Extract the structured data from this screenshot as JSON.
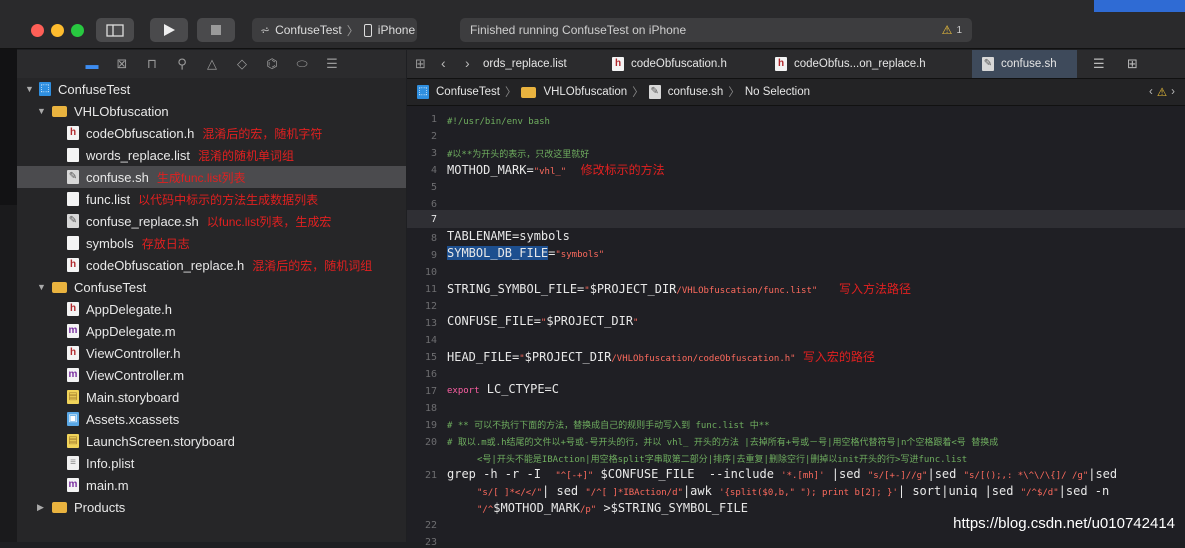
{
  "toolbar": {
    "scheme_name": "ConfuseTest",
    "device_name": "iPhone",
    "status_text": "Finished running ConfuseTest on iPhone",
    "warning_count": "1"
  },
  "navigator": {
    "icons": [
      "folder-icon",
      "x-square-icon",
      "hierarchy-icon",
      "search-icon",
      "warning-icon",
      "diamond-icon",
      "debug-icon",
      "tag-icon",
      "list-icon"
    ],
    "items": [
      {
        "label": "ConfuseTest",
        "note": ""
      },
      {
        "label": "VHLObfuscation",
        "note": ""
      },
      {
        "label": "codeObfuscation.h",
        "note": "混淆后的宏，随机字符"
      },
      {
        "label": "words_replace.list",
        "note": "混淆的随机单词组"
      },
      {
        "label": "confuse.sh",
        "note": "生成func.list列表"
      },
      {
        "label": "func.list",
        "note": "以代码中标示的方法生成数据列表"
      },
      {
        "label": "confuse_replace.sh",
        "note": "以func.list列表，生成宏"
      },
      {
        "label": "symbols",
        "note": "存放日志"
      },
      {
        "label": "codeObfuscation_replace.h",
        "note": "混淆后的宏，随机词组"
      },
      {
        "label": "ConfuseTest",
        "note": ""
      },
      {
        "label": "AppDelegate.h",
        "note": ""
      },
      {
        "label": "AppDelegate.m",
        "note": ""
      },
      {
        "label": "ViewController.h",
        "note": ""
      },
      {
        "label": "ViewController.m",
        "note": ""
      },
      {
        "label": "Main.storyboard",
        "note": ""
      },
      {
        "label": "Assets.xcassets",
        "note": ""
      },
      {
        "label": "LaunchScreen.storyboard",
        "note": ""
      },
      {
        "label": "Info.plist",
        "note": ""
      },
      {
        "label": "main.m",
        "note": ""
      },
      {
        "label": "Products",
        "note": ""
      }
    ]
  },
  "tabs": [
    {
      "label": "ords_replace.list"
    },
    {
      "label": "codeObfuscation.h"
    },
    {
      "label": "codeObfus...on_replace.h"
    },
    {
      "label": "confuse.sh"
    }
  ],
  "jumpbar": {
    "crumbs": [
      "ConfuseTest",
      "VHLObfuscation",
      "confuse.sh",
      "No Selection"
    ]
  },
  "editor": {
    "line_numbers": [
      "1",
      "2",
      "3",
      "4",
      "5",
      "6",
      "7",
      "8",
      "9",
      "10",
      "11",
      "12",
      "13",
      "14",
      "15",
      "16",
      "17",
      "18",
      "19",
      "20",
      "21",
      "22",
      "23"
    ],
    "l1": "#!/usr/bin/env bash",
    "l3": "#以**为开头的表示，只改这里就好",
    "l4a": "MOTHOD_MARK=",
    "l4b": "\"vhl_\"",
    "l4c": "修改标示的方法",
    "l8": "TABLENAME=symbols",
    "l9a": "SYMBOL_DB_FILE",
    "l9b": "=",
    "l9c": "\"symbols\"",
    "l11a": "STRING_SYMBOL_FILE=",
    "l11b": "\"",
    "l11c": "$PROJECT_DIR",
    "l11d": "/VHLObfuscation/func.list\"",
    "l11e": "写入方法路径",
    "l13a": "CONFUSE_FILE=",
    "l13b": "\"",
    "l13c": "$PROJECT_DIR",
    "l13d": "\"",
    "l15a": "HEAD_FILE=",
    "l15b": "\"",
    "l15c": "$PROJECT_DIR",
    "l15d": "/VHLObfuscation/codeObfuscation.h\"",
    "l15e": "写入宏的路径",
    "l17a": "export",
    "l17b": " LC_CTYPE=C",
    "l19": "# ** 可以不执行下面的方法，替换成自己的规则手动写入到 func.list 中**",
    "l20a": "# 取以.m或.h结尾的文件以+号或-号开头的行，并以 vhl_ 开头的方法 |去掉所有+号或－号|用空格代替符号|n个空格跟着<号 替换成",
    "l20b": "<号|开头不能是IBAction|用空格split字串取第二部分|排序|去重复|删除空行|删掉以init开头的行>写进func.list",
    "l21a": "grep -h -r -I  ",
    "l21b": "\"^[-+]\"",
    "l21c": " $CONFUSE_FILE  --include ",
    "l21d": "'*.[mh]'",
    "l21e": " |sed ",
    "l21f": "\"s/[+-]//g\"",
    "l21g": "|sed ",
    "l21h": "\"s/[();,: *\\^\\/\\{]/ /g\"",
    "l21i": "|sed",
    "l21j": "\"s/[ ]*</</\"",
    "l21k": "| sed ",
    "l21l": "\"/^[ ]*IBAction/d\"",
    "l21m": "|awk ",
    "l21n": "'{split($0,b,\" \"); print b[2]; }'",
    "l21o": "| sort|uniq |sed ",
    "l21p": "\"/^$/d\"",
    "l21q": "|sed -n",
    "l21r": "\"/^",
    "l21s": "$MOTHOD_MARK",
    "l21t": "/p\"",
    "l21u": " >$STRING_SYMBOL_FILE"
  },
  "watermark": "https://blog.csdn.net/u010742414"
}
